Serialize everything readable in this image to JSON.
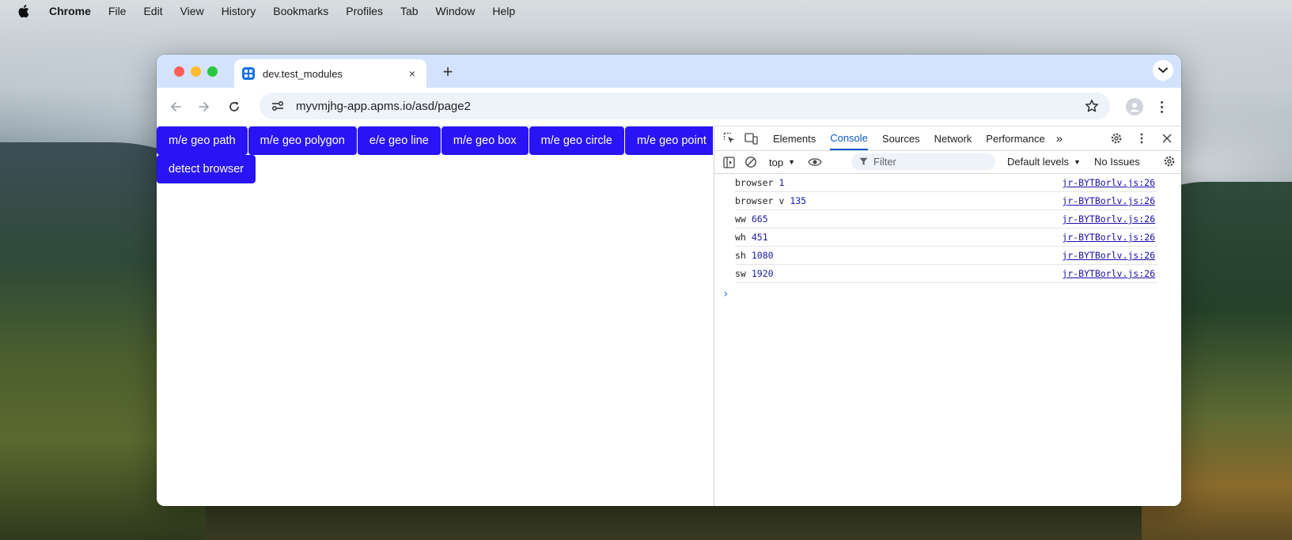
{
  "menubar": {
    "app_name": "Chrome",
    "items": [
      "File",
      "Edit",
      "View",
      "History",
      "Bookmarks",
      "Profiles",
      "Tab",
      "Window",
      "Help"
    ]
  },
  "tab": {
    "title": "dev.test_modules",
    "close": "×"
  },
  "toolbar": {
    "new_tab": "+",
    "url": "myvmjhg-app.apms.io/asd/page2"
  },
  "page": {
    "buttons": [
      "m/e geo path",
      "m/e geo polygon",
      "e/e geo line",
      "m/e geo box",
      "m/e geo circle",
      "m/e geo point"
    ],
    "detect_button": "detect browser"
  },
  "devtools": {
    "tabs": [
      "Elements",
      "Console",
      "Sources",
      "Network",
      "Performance"
    ],
    "active_tab": "Console",
    "more": "»",
    "context": "top",
    "filter_placeholder": "Filter",
    "levels": "Default levels",
    "issues": "No Issues",
    "logs": [
      {
        "msg": "browser",
        "value": "1",
        "source": "jr-BYTBorlv.js:26"
      },
      {
        "msg": "browser v",
        "value": "135",
        "source": "jr-BYTBorlv.js:26"
      },
      {
        "msg": "ww",
        "value": "665",
        "source": "jr-BYTBorlv.js:26"
      },
      {
        "msg": "wh",
        "value": "451",
        "source": "jr-BYTBorlv.js:26"
      },
      {
        "msg": "sh",
        "value": "1080",
        "source": "jr-BYTBorlv.js:26"
      },
      {
        "msg": "sw",
        "value": "1920",
        "source": "jr-BYTBorlv.js:26"
      }
    ],
    "prompt": "›"
  },
  "colors": {
    "page_button": "#2a14f5",
    "active_tab": "#0b57d0",
    "tabstrip": "#d3e3fd"
  }
}
